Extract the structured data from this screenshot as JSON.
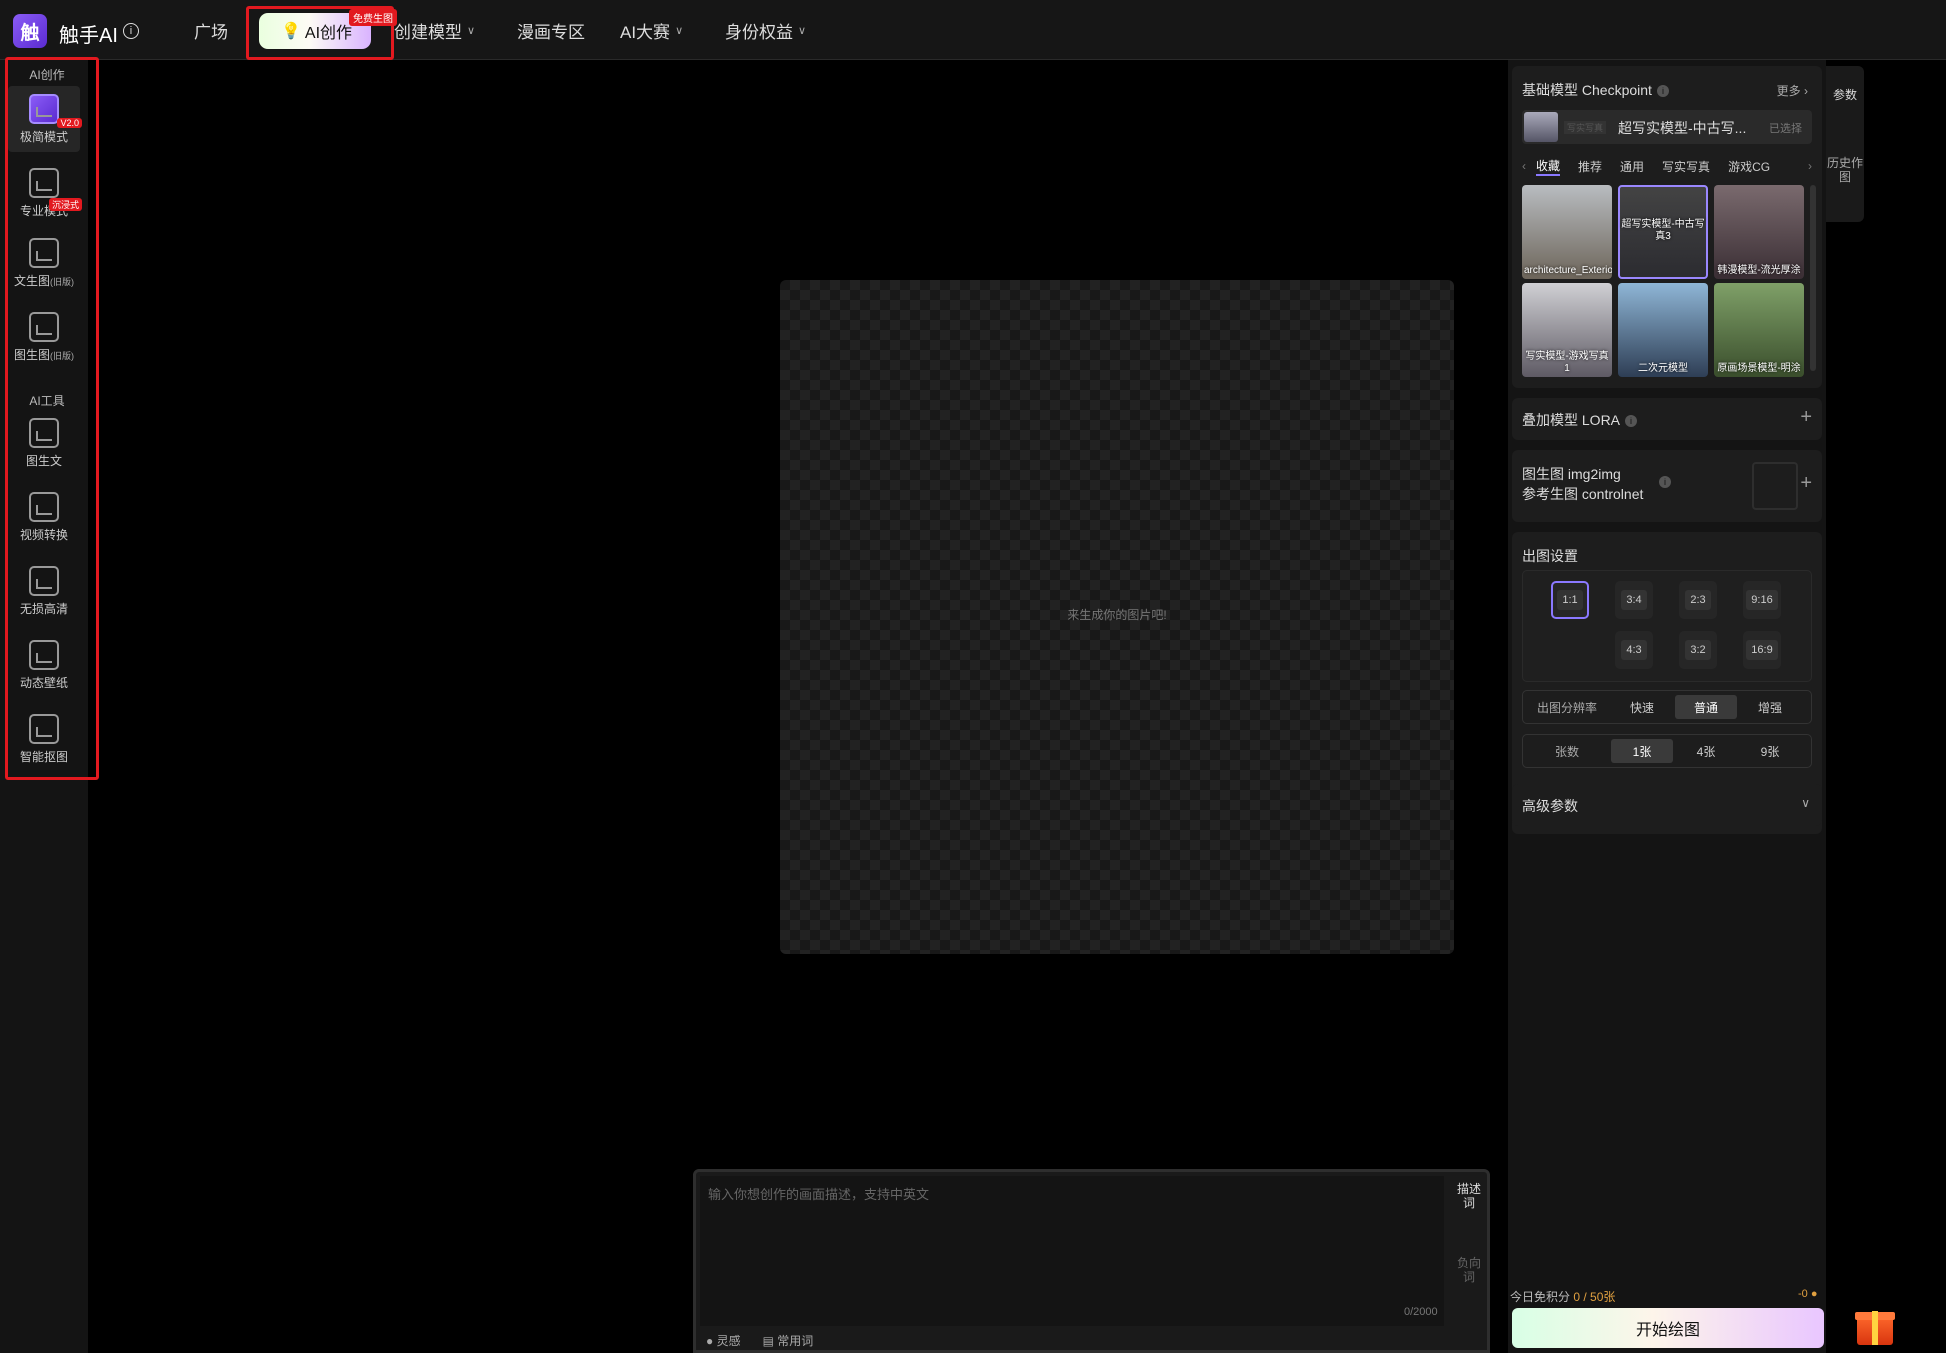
{
  "topbar": {
    "brand": "触手AI",
    "logo_char": "触",
    "nav": [
      {
        "label": "广场"
      },
      {
        "label": "AI创作",
        "badge": "免费生图"
      },
      {
        "label": "创建模型"
      },
      {
        "label": "漫画专区"
      },
      {
        "label": "AI大赛"
      },
      {
        "label": "身份权益"
      }
    ]
  },
  "sidebar": {
    "section_create": "AI创作",
    "section_tools": "AI工具",
    "items": [
      {
        "label": "极简模式",
        "badge": "V2.0"
      },
      {
        "label": "专业模式",
        "badge": "沉浸式"
      },
      {
        "label": "文生图",
        "sub": "(旧版)"
      },
      {
        "label": "图生图",
        "sub": "(旧版)"
      },
      {
        "label": "图生文"
      },
      {
        "label": "视频转换"
      },
      {
        "label": "无损高清"
      },
      {
        "label": "动态壁纸"
      },
      {
        "label": "智能抠图"
      }
    ]
  },
  "canvas": {
    "hint": "来生成你的图片吧!"
  },
  "prompt": {
    "placeholder": "输入你想创作的画面描述，支持中英文",
    "count": "0/2000",
    "tab_describe": "描述词",
    "tab_negative": "负向词",
    "foot_inspiration": "灵感",
    "foot_common": "常用词"
  },
  "right": {
    "checkpoint_title": "基础模型 Checkpoint",
    "more": "更多",
    "selected_model_tag": "写实写真",
    "selected_model": "超写实模型-中古写...",
    "selected_state": "已选择",
    "cat_tabs": [
      "收藏",
      "推荐",
      "通用",
      "写实写真",
      "游戏CG"
    ],
    "models": [
      {
        "name": "architecture_Exterior",
        "color": "#8f8a80"
      },
      {
        "name": "超写实模型-中古写真3",
        "color": "#3a3a40"
      },
      {
        "name": "韩漫模型-流光厚涂",
        "color": "#5a4a52"
      },
      {
        "name": "写实模型-游戏写真1",
        "color": "#6e6a72"
      },
      {
        "name": "二次元模型",
        "color": "#3c5a7a"
      },
      {
        "name": "原画场景模型-明涂",
        "color": "#4e6e3e"
      }
    ],
    "lora_title": "叠加模型 LORA",
    "img2img_title": "图生图 img2img",
    "controlnet_title": "参考生图 controlnet",
    "output_title": "出图设置",
    "ratios": [
      "1:1",
      "3:4",
      "2:3",
      "9:16",
      "4:3",
      "3:2",
      "16:9"
    ],
    "resolution_label": "出图分辨率",
    "resolution_opts": [
      "快速",
      "普通",
      "增强"
    ],
    "count_label": "张数",
    "count_opts": [
      "1张",
      "4张",
      "9张"
    ],
    "advanced_title": "高级参数",
    "quota_label": "今日免积分",
    "quota_value": "0 / 50张",
    "quota_right": "-0",
    "start_label": "开始绘图",
    "vtab_params": "参数",
    "vtab_history": "历史作图"
  }
}
